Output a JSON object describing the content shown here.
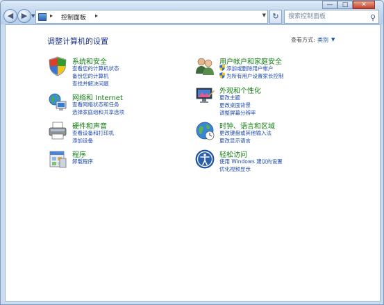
{
  "window": {
    "address_crumb": "控制面板",
    "search_placeholder": "搜索控制面板"
  },
  "header": {
    "title": "调整计算机的设置",
    "view_label": "查看方式:",
    "view_value": "类别"
  },
  "categories": {
    "system": {
      "title": "系统和安全",
      "links": [
        "查看您的计算机状态",
        "备份您的计算机",
        "查找并解决问题"
      ]
    },
    "network": {
      "title": "网络和 Internet",
      "links": [
        "查看网络状态和任务",
        "选择家庭组和共享选项"
      ]
    },
    "hardware": {
      "title": "硬件和声音",
      "links": [
        "查看设备和打印机",
        "添加设备"
      ]
    },
    "programs": {
      "title": "程序",
      "links": [
        "卸载程序"
      ]
    },
    "accounts": {
      "title": "用户帐户和家庭安全",
      "links": [
        "添加或删除用户帐户",
        "为所有用户设置家长控制"
      ]
    },
    "appearance": {
      "title": "外观和个性化",
      "links": [
        "更改主题",
        "更改桌面背景",
        "调整屏幕分辨率"
      ]
    },
    "clock": {
      "title": "时钟、语言和区域",
      "links": [
        "更改键盘或其他输入法",
        "更改显示语言"
      ]
    },
    "ease": {
      "title": "轻松访问",
      "links": [
        "使用 Windows 建议的设置",
        "优化视频显示"
      ]
    }
  },
  "colors": {
    "category_title": "#127b12",
    "link": "#1f4bb0",
    "page_title": "#1e3287"
  }
}
